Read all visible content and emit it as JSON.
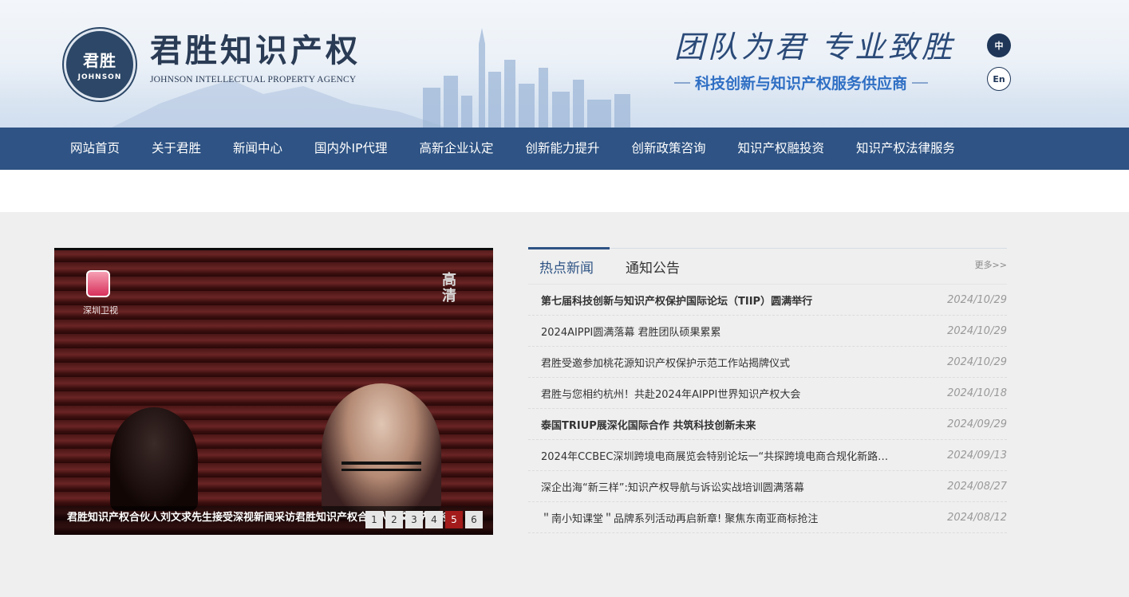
{
  "header": {
    "logo_cn": "君胜",
    "logo_en": "JOHNSON",
    "brand_cn": "君胜知识产权",
    "brand_en": "JOHNSON INTELLECTUAL PROPERTY AGENCY",
    "slogan": "团队为君 专业致胜",
    "sub_slogan": "科技创新与知识产权服务供应商",
    "lang_zh": "中",
    "lang_en": "En"
  },
  "nav": {
    "items": [
      "网站首页",
      "关于君胜",
      "新闻中心",
      "国内外IP代理",
      "高新企业认定",
      "创新能力提升",
      "创新政策咨询",
      "知识产权融投资",
      "知识产权法律服务"
    ]
  },
  "slider": {
    "tv_text": "深圳卫视",
    "hd_text": "高清",
    "caption": "君胜知识产权合伙人刘文求先生接受深视新闻采访君胜知识产权合伙人刘文求先生接受",
    "pages": [
      "1",
      "2",
      "3",
      "4",
      "5",
      "6"
    ],
    "active_page": "5"
  },
  "news": {
    "tab_hot": "热点新闻",
    "tab_notice": "通知公告",
    "more": "更多>>",
    "items": [
      {
        "title": "第七届科技创新与知识产权保护国际论坛（TIIP）圆满举行",
        "date": "2024/10/29",
        "bold": true
      },
      {
        "title": "2024AIPPI圆满落幕 君胜团队硕果累累",
        "date": "2024/10/29",
        "bold": false
      },
      {
        "title": "君胜受邀参加桃花源知识产权保护示范工作站揭牌仪式",
        "date": "2024/10/29",
        "bold": false
      },
      {
        "title": "君胜与您相约杭州！共赴2024年AIPPI世界知识产权大会",
        "date": "2024/10/18",
        "bold": false
      },
      {
        "title": "泰国TRIUP展深化国际合作 共筑科技创新未来",
        "date": "2024/09/29",
        "bold": true
      },
      {
        "title": "2024年CCBEC深圳跨境电商展览会特别论坛一“共探跨境电商合规化新路…",
        "date": "2024/09/13",
        "bold": false
      },
      {
        "title": "深企出海“新三样”:知识产权导航与诉讼实战培训圆满落幕",
        "date": "2024/08/27",
        "bold": false
      },
      {
        "title": "＂南小知课堂＂品牌系列活动再启新章! 聚焦东南亚商标抢注",
        "date": "2024/08/12",
        "bold": false
      }
    ]
  }
}
